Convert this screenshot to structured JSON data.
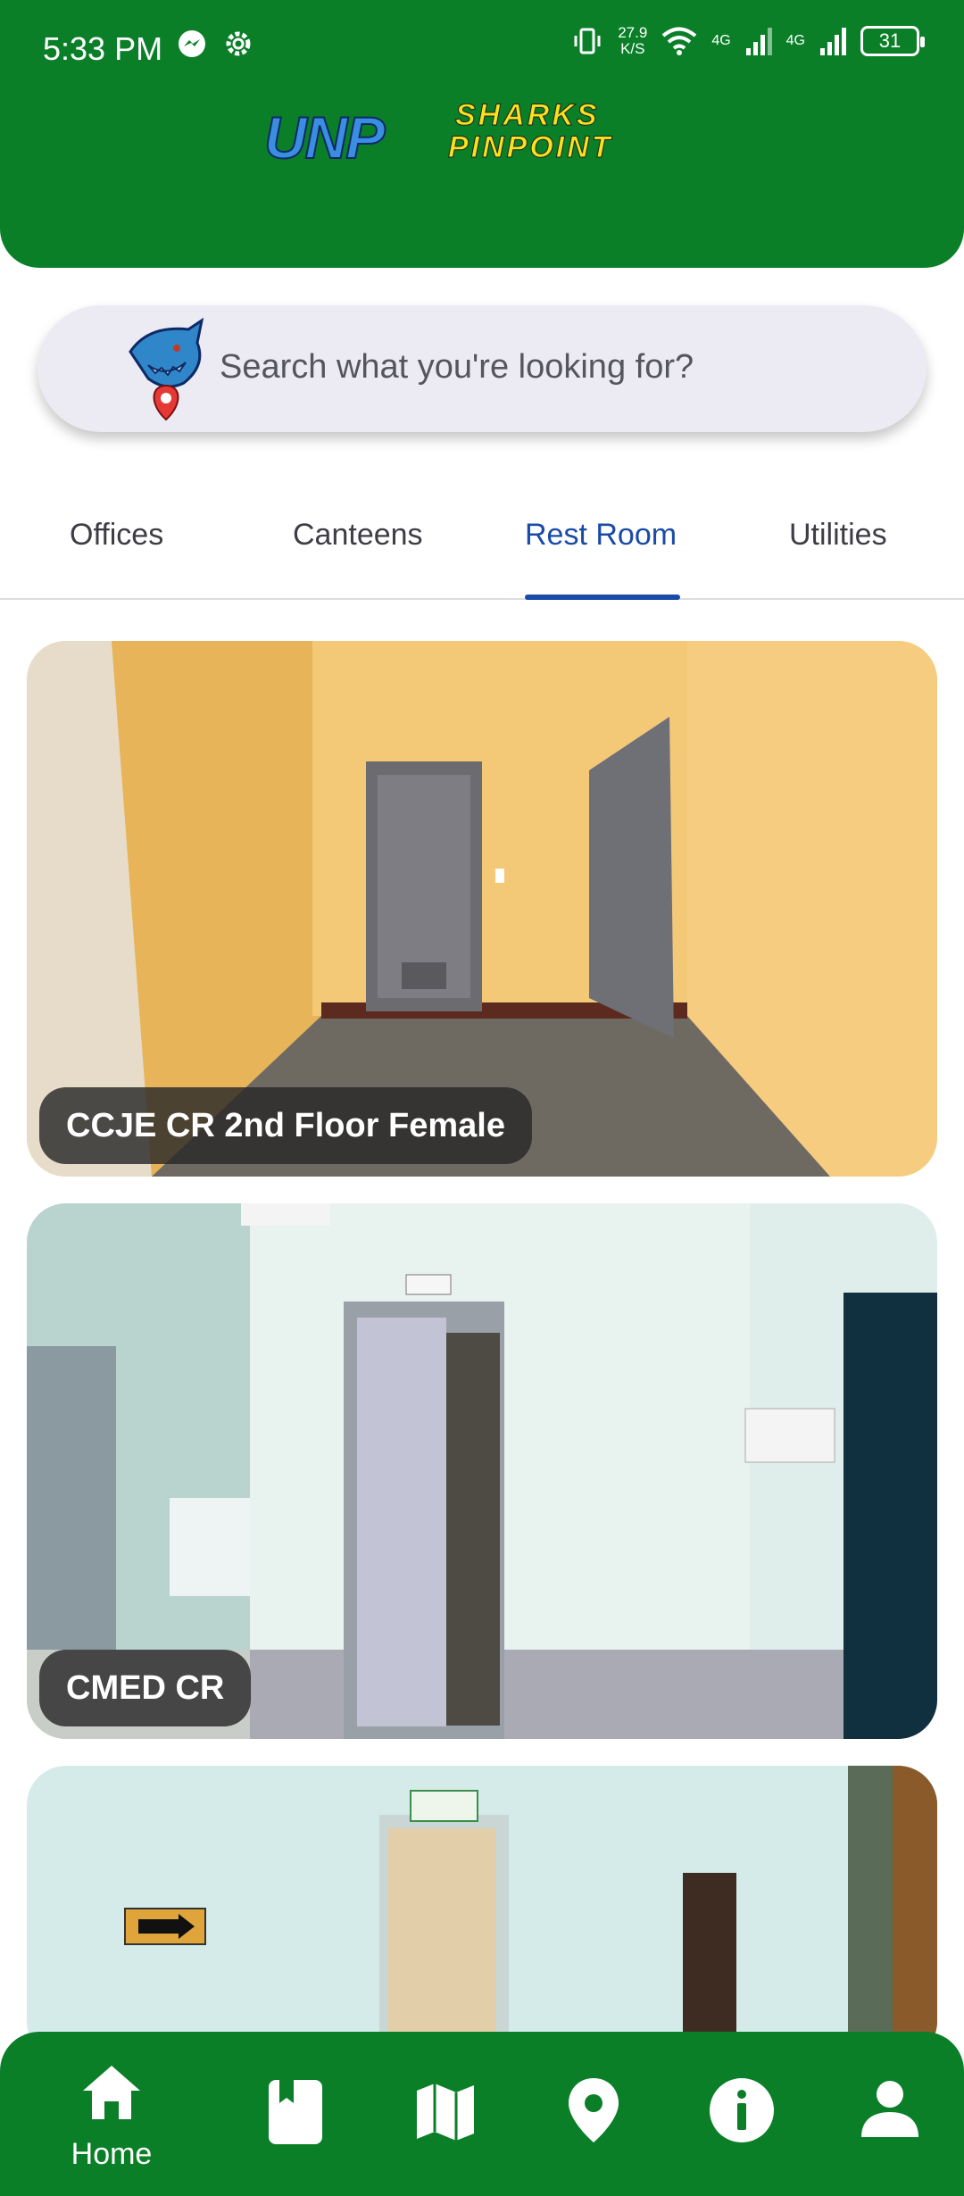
{
  "status_bar": {
    "time": "5:33 PM",
    "net_speed_value": "27.9",
    "net_speed_unit": "K/S",
    "network_1": "4G",
    "network_2": "4G",
    "battery": "31"
  },
  "header": {
    "logo_unp": "UNP",
    "logo_sharks": "SHARKS",
    "logo_pinpoint": "PINPOINT"
  },
  "search": {
    "placeholder": "Search what you're looking for?"
  },
  "tabs": [
    {
      "label": "Offices",
      "active": false
    },
    {
      "label": "Canteens",
      "active": false
    },
    {
      "label": "Rest Room",
      "active": true
    },
    {
      "label": "Utilities",
      "active": false
    }
  ],
  "cards": [
    {
      "title": "CCJE CR 2nd Floor Female"
    },
    {
      "title": "CMED CR"
    },
    {
      "title": ""
    }
  ],
  "bottom_nav": [
    {
      "icon": "home-icon",
      "label": "Home",
      "active": true
    },
    {
      "icon": "book-icon",
      "label": ""
    },
    {
      "icon": "map-icon",
      "label": ""
    },
    {
      "icon": "location-pin-icon",
      "label": ""
    },
    {
      "icon": "info-icon",
      "label": ""
    },
    {
      "icon": "profile-icon",
      "label": ""
    }
  ],
  "colors": {
    "brand_green": "#0a7f28",
    "active_tab": "#1a4ba8"
  }
}
